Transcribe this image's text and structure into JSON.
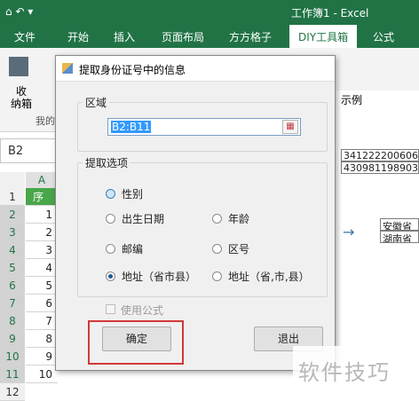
{
  "titlebar": {
    "qa_icons": "⌂ ↶ ▾",
    "title": "工作簿1 - Excel",
    "bg": "#217346"
  },
  "tabs": [
    "文件",
    "开始",
    "插入",
    "页面布局",
    "方方格子",
    "DIY工具箱",
    "公式"
  ],
  "ribbon": {
    "receive_label": "收",
    "receive_label2": "纳箱",
    "my_label": "我的"
  },
  "namebox": "B2",
  "grid": {
    "col_a": "A",
    "rows": [
      "1",
      "2",
      "3",
      "4",
      "5",
      "6",
      "7",
      "8",
      "9",
      "10",
      "11",
      "12",
      "13"
    ],
    "values": [
      "序号",
      "1",
      "2",
      "3",
      "4",
      "5",
      "6",
      "7",
      "8",
      "9",
      "10",
      "",
      ""
    ]
  },
  "dialog": {
    "title": "提取身份证号中的信息",
    "region_label": "区域",
    "region_value": "B2:B11",
    "options_label": "提取选项",
    "options": [
      {
        "label": "性别",
        "checked": false
      },
      {
        "label": "出生日期",
        "checked": false
      },
      {
        "label": "年龄",
        "checked": false
      },
      {
        "label": "邮编",
        "checked": false
      },
      {
        "label": "区号",
        "checked": false
      },
      {
        "label": "地址（省市县）",
        "checked": true
      },
      {
        "label": "地址（省,市,县）",
        "checked": false
      }
    ],
    "use_formula": "使用公式",
    "ok": "确定",
    "cancel": "退出"
  },
  "example": {
    "label": "示例",
    "ids": [
      "341222200606",
      "430981198903"
    ],
    "results": [
      "安徽省",
      "湖南省"
    ],
    "arrow": "→"
  },
  "watermark": "软件技巧",
  "highlight_color": "#d03a3a"
}
